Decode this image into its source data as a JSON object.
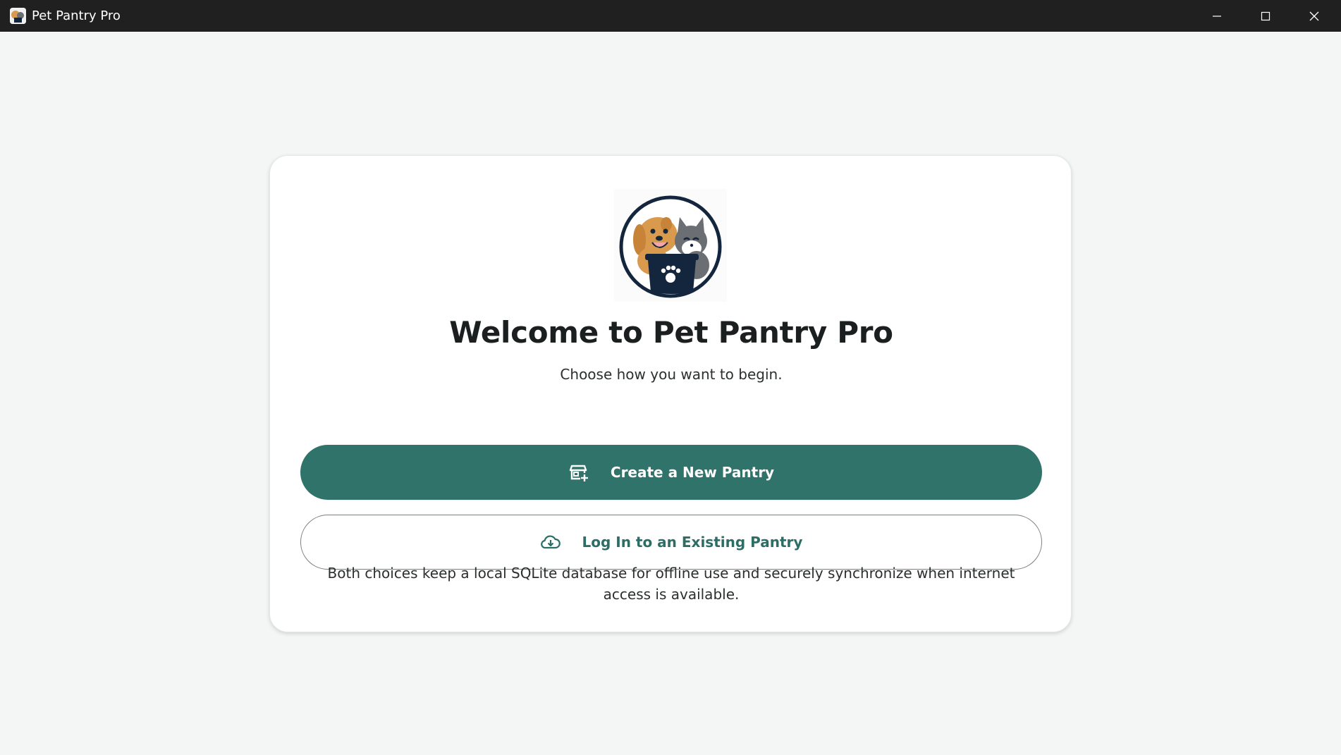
{
  "window": {
    "title": "Pet Pantry Pro",
    "controls": {
      "minimize_icon": "minimize-icon",
      "maximize_icon": "maximize-icon",
      "close_icon": "close-icon"
    }
  },
  "welcome": {
    "logo_icon": "dog-cat-food-bowl-logo",
    "headline": "Welcome to Pet Pantry Pro",
    "subheadline": "Choose how you want to begin.",
    "primary_button": {
      "label": "Create a New Pantry",
      "icon": "storefront-add-icon"
    },
    "secondary_button": {
      "label": "Log In to an Existing Pantry",
      "icon": "cloud-download-icon"
    },
    "footnote": "Both choices keep a local SQLite database for offline use and securely synchronize when internet access is available."
  },
  "colors": {
    "titlebar": "#202020",
    "page_background": "#f4f6f6",
    "accent": "#2f736b",
    "card": "#ffffff",
    "text": "#1b1f1f"
  }
}
